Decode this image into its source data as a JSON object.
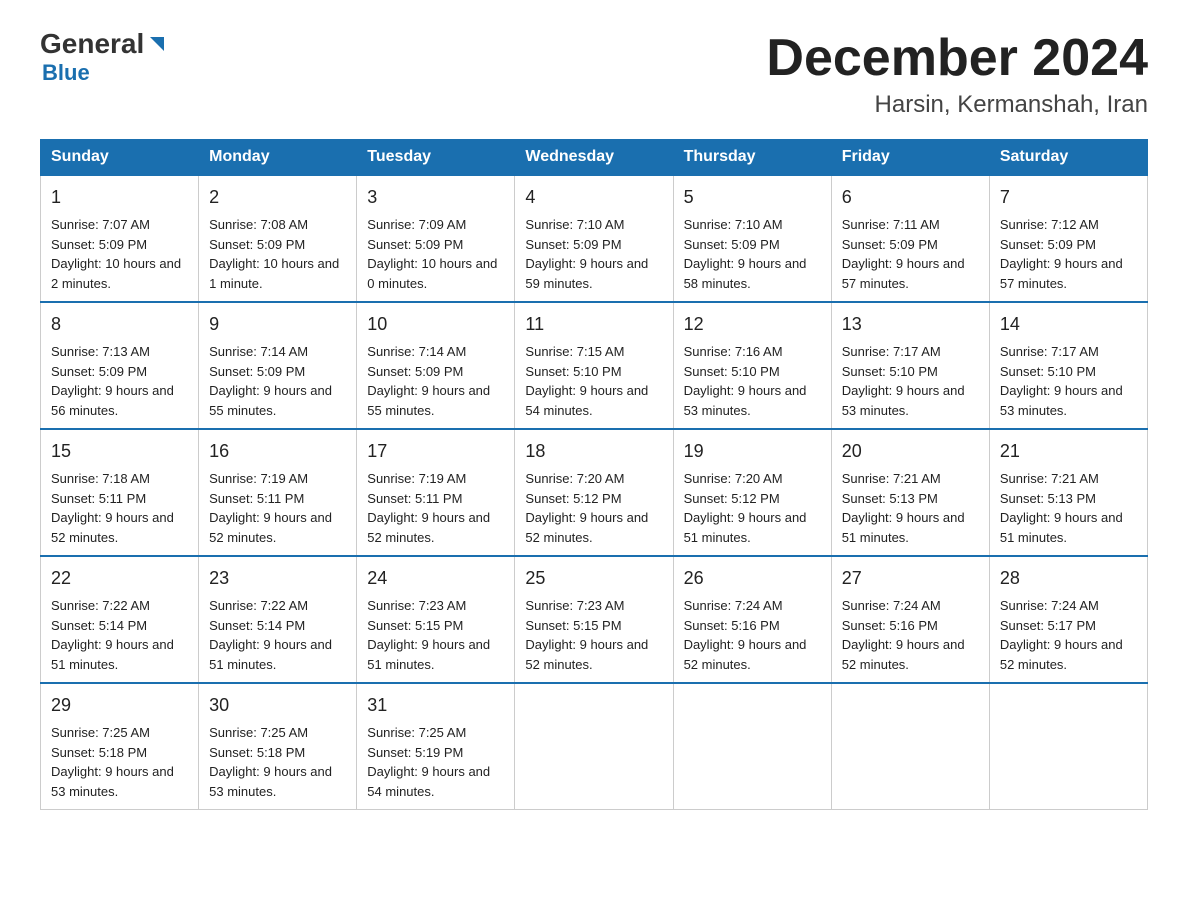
{
  "header": {
    "logo_general": "General",
    "logo_blue": "Blue",
    "month_title": "December 2024",
    "location": "Harsin, Kermanshah, Iran"
  },
  "days_of_week": [
    "Sunday",
    "Monday",
    "Tuesday",
    "Wednesday",
    "Thursday",
    "Friday",
    "Saturday"
  ],
  "weeks": [
    [
      {
        "day": "1",
        "sunrise": "7:07 AM",
        "sunset": "5:09 PM",
        "daylight": "10 hours and 2 minutes."
      },
      {
        "day": "2",
        "sunrise": "7:08 AM",
        "sunset": "5:09 PM",
        "daylight": "10 hours and 1 minute."
      },
      {
        "day": "3",
        "sunrise": "7:09 AM",
        "sunset": "5:09 PM",
        "daylight": "10 hours and 0 minutes."
      },
      {
        "day": "4",
        "sunrise": "7:10 AM",
        "sunset": "5:09 PM",
        "daylight": "9 hours and 59 minutes."
      },
      {
        "day": "5",
        "sunrise": "7:10 AM",
        "sunset": "5:09 PM",
        "daylight": "9 hours and 58 minutes."
      },
      {
        "day": "6",
        "sunrise": "7:11 AM",
        "sunset": "5:09 PM",
        "daylight": "9 hours and 57 minutes."
      },
      {
        "day": "7",
        "sunrise": "7:12 AM",
        "sunset": "5:09 PM",
        "daylight": "9 hours and 57 minutes."
      }
    ],
    [
      {
        "day": "8",
        "sunrise": "7:13 AM",
        "sunset": "5:09 PM",
        "daylight": "9 hours and 56 minutes."
      },
      {
        "day": "9",
        "sunrise": "7:14 AM",
        "sunset": "5:09 PM",
        "daylight": "9 hours and 55 minutes."
      },
      {
        "day": "10",
        "sunrise": "7:14 AM",
        "sunset": "5:09 PM",
        "daylight": "9 hours and 55 minutes."
      },
      {
        "day": "11",
        "sunrise": "7:15 AM",
        "sunset": "5:10 PM",
        "daylight": "9 hours and 54 minutes."
      },
      {
        "day": "12",
        "sunrise": "7:16 AM",
        "sunset": "5:10 PM",
        "daylight": "9 hours and 53 minutes."
      },
      {
        "day": "13",
        "sunrise": "7:17 AM",
        "sunset": "5:10 PM",
        "daylight": "9 hours and 53 minutes."
      },
      {
        "day": "14",
        "sunrise": "7:17 AM",
        "sunset": "5:10 PM",
        "daylight": "9 hours and 53 minutes."
      }
    ],
    [
      {
        "day": "15",
        "sunrise": "7:18 AM",
        "sunset": "5:11 PM",
        "daylight": "9 hours and 52 minutes."
      },
      {
        "day": "16",
        "sunrise": "7:19 AM",
        "sunset": "5:11 PM",
        "daylight": "9 hours and 52 minutes."
      },
      {
        "day": "17",
        "sunrise": "7:19 AM",
        "sunset": "5:11 PM",
        "daylight": "9 hours and 52 minutes."
      },
      {
        "day": "18",
        "sunrise": "7:20 AM",
        "sunset": "5:12 PM",
        "daylight": "9 hours and 52 minutes."
      },
      {
        "day": "19",
        "sunrise": "7:20 AM",
        "sunset": "5:12 PM",
        "daylight": "9 hours and 51 minutes."
      },
      {
        "day": "20",
        "sunrise": "7:21 AM",
        "sunset": "5:13 PM",
        "daylight": "9 hours and 51 minutes."
      },
      {
        "day": "21",
        "sunrise": "7:21 AM",
        "sunset": "5:13 PM",
        "daylight": "9 hours and 51 minutes."
      }
    ],
    [
      {
        "day": "22",
        "sunrise": "7:22 AM",
        "sunset": "5:14 PM",
        "daylight": "9 hours and 51 minutes."
      },
      {
        "day": "23",
        "sunrise": "7:22 AM",
        "sunset": "5:14 PM",
        "daylight": "9 hours and 51 minutes."
      },
      {
        "day": "24",
        "sunrise": "7:23 AM",
        "sunset": "5:15 PM",
        "daylight": "9 hours and 51 minutes."
      },
      {
        "day": "25",
        "sunrise": "7:23 AM",
        "sunset": "5:15 PM",
        "daylight": "9 hours and 52 minutes."
      },
      {
        "day": "26",
        "sunrise": "7:24 AM",
        "sunset": "5:16 PM",
        "daylight": "9 hours and 52 minutes."
      },
      {
        "day": "27",
        "sunrise": "7:24 AM",
        "sunset": "5:16 PM",
        "daylight": "9 hours and 52 minutes."
      },
      {
        "day": "28",
        "sunrise": "7:24 AM",
        "sunset": "5:17 PM",
        "daylight": "9 hours and 52 minutes."
      }
    ],
    [
      {
        "day": "29",
        "sunrise": "7:25 AM",
        "sunset": "5:18 PM",
        "daylight": "9 hours and 53 minutes."
      },
      {
        "day": "30",
        "sunrise": "7:25 AM",
        "sunset": "5:18 PM",
        "daylight": "9 hours and 53 minutes."
      },
      {
        "day": "31",
        "sunrise": "7:25 AM",
        "sunset": "5:19 PM",
        "daylight": "9 hours and 54 minutes."
      },
      null,
      null,
      null,
      null
    ]
  ]
}
